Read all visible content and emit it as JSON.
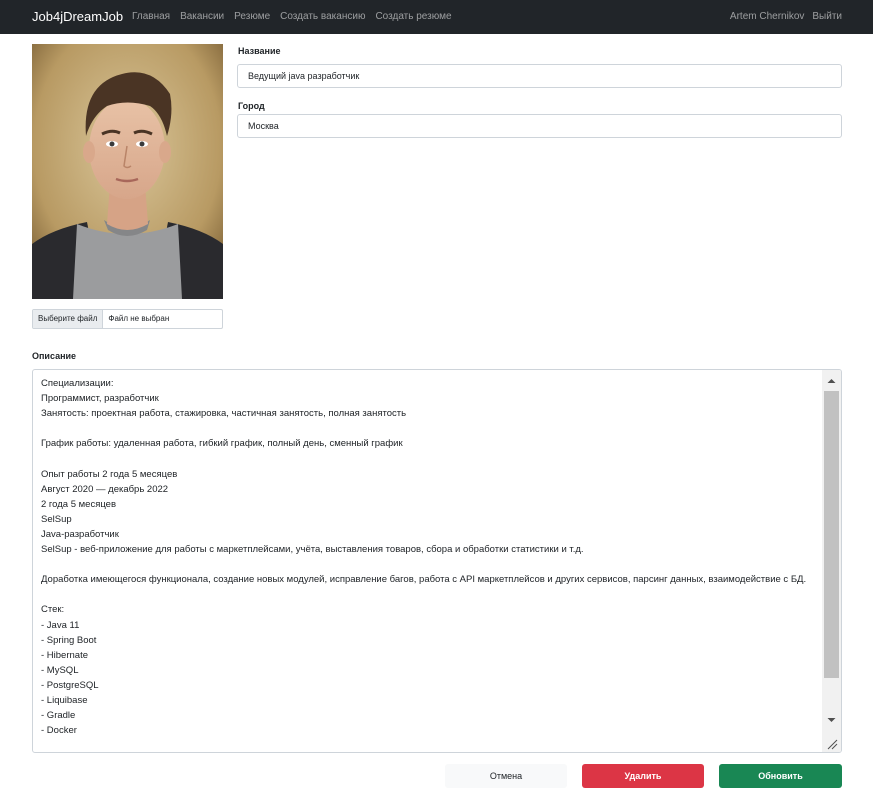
{
  "navbar": {
    "brand": "Job4jDreamJob",
    "links": [
      "Главная",
      "Вакансии",
      "Резюме",
      "Создать вакансию",
      "Создать резюме"
    ],
    "user": "Artem Chernikov",
    "logout": "Выйти"
  },
  "photo": {
    "file_button": "Выберите файл",
    "file_status": "Файл не выбран"
  },
  "form": {
    "name_label": "Название",
    "name_value": "Ведущий java разработчик",
    "city_label": "Город",
    "city_value": "Москва",
    "description_label": "Описание",
    "description_value": "Специализации:\nПрограммист, разработчик\nЗанятость: проектная работа, стажировка, частичная занятость, полная занятость\n\nГрафик работы: удаленная работа, гибкий график, полный день, сменный график\n\nОпыт работы 2 года 5 месяцев\nАвгуст 2020 — декабрь 2022\n2 года 5 месяцев\nSelSup\nJava-разработчик\nSelSup - веб-приложение для работы с маркетплейсами, учёта, выставления товаров, сбора и обработки статистики и т.д.\n\nДоработка имеющегося функционала, создание новых модулей, исправление багов, работа с API маркетплейсов и других сервисов, парсинг данных, взаимодействие с БД.\n\nСтек:\n- Java 11\n- Spring Boot\n- Hibernate\n- MySQL\n- PostgreSQL\n- Liquibase\n- Gradle\n- Docker"
  },
  "buttons": {
    "cancel": "Отмена",
    "delete": "Удалить",
    "update": "Обновить"
  },
  "colors": {
    "navbar_bg": "#212529",
    "delete": "#dc3545",
    "update": "#198754"
  }
}
